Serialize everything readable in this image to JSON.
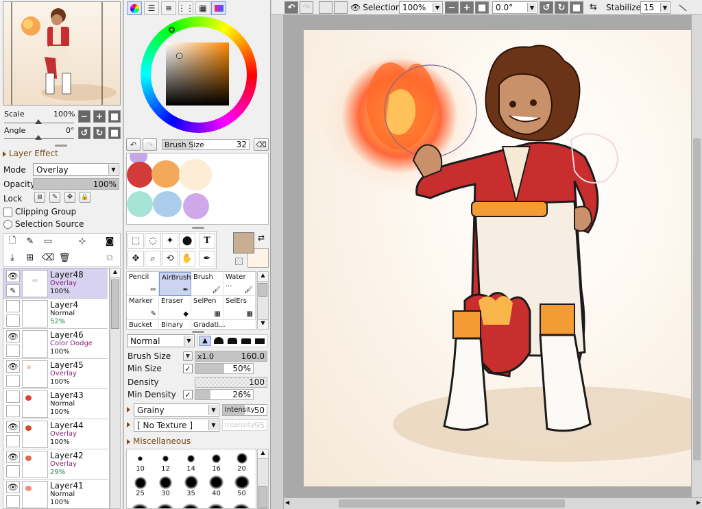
{
  "navigator": {
    "scale_label": "Scale",
    "scale_value": "100%",
    "angle_label": "Angle",
    "angle_value": "0°"
  },
  "layer_effect": {
    "title": "Layer Effect",
    "mode_label": "Mode",
    "mode_value": "Overlay",
    "opacity_label": "Opacity",
    "opacity_value": "100%",
    "lock_label": "Lock",
    "clipping_label": "Clipping Group",
    "selection_source_label": "Selection Source"
  },
  "layers": [
    {
      "name": "Layer48",
      "mode": "Overlay",
      "opacity": "100%",
      "visible": true,
      "selected": true
    },
    {
      "name": "Layer4",
      "mode": "Normal",
      "opacity": "52%",
      "visible": false,
      "selected": false
    },
    {
      "name": "Layer46",
      "mode": "Color Dodge",
      "opacity": "100%",
      "visible": true,
      "selected": false
    },
    {
      "name": "Layer45",
      "mode": "Overlay",
      "opacity": "100%",
      "visible": true,
      "selected": false
    },
    {
      "name": "Layer43",
      "mode": "Normal",
      "opacity": "100%",
      "visible": false,
      "selected": false
    },
    {
      "name": "Layer44",
      "mode": "Overlay",
      "opacity": "100%",
      "visible": true,
      "selected": false
    },
    {
      "name": "Layer42",
      "mode": "Overlay",
      "opacity": "29%",
      "visible": true,
      "selected": false
    },
    {
      "name": "Layer41",
      "mode": "Normal",
      "opacity": "100%",
      "visible": true,
      "selected": false
    }
  ],
  "brush_size_bar": {
    "label": "Brush Size",
    "value": "32"
  },
  "swatches": [
    "#c7a7e6",
    "#d33a3a",
    "#f4a95a",
    "#fdecd6",
    "#a6e4d6",
    "#a9cdea",
    "#cfa8ea"
  ],
  "colors": {
    "primary": "#c8ae92",
    "secondary": "#fdf3e6",
    "accent_selection": "#d6d2f0"
  },
  "tools": {
    "row1": [
      "rect-select",
      "lasso",
      "magic-wand",
      "select-pen",
      "text"
    ],
    "row2": [
      "move",
      "zoom",
      "rotate",
      "hand",
      "eyedropper"
    ],
    "text_tool_label": "T"
  },
  "brush_tools": [
    {
      "name": "Pencil",
      "selected": false
    },
    {
      "name": "AirBrush",
      "selected": true
    },
    {
      "name": "Brush",
      "selected": false
    },
    {
      "name": "Water ...",
      "selected": false
    },
    {
      "name": "Marker",
      "selected": false
    },
    {
      "name": "Eraser",
      "selected": false
    },
    {
      "name": "SelPen",
      "selected": false
    },
    {
      "name": "SelErs",
      "selected": false
    },
    {
      "name": "Bucket",
      "selected": false
    },
    {
      "name": "Binary ...",
      "selected": false
    },
    {
      "name": "Gradati...",
      "selected": false
    }
  ],
  "brush_settings": {
    "blend_mode": "Normal",
    "brush_size_label": "Brush Size",
    "brush_size_mult": "x1.0",
    "brush_size_value": "160.0",
    "min_size_label": "Min Size",
    "min_size_value": "50%",
    "min_size_fill": 0.5,
    "density_label": "Density",
    "density_value": "100",
    "min_density_label": "Min Density",
    "min_density_value": "26%",
    "min_density_fill": 0.26,
    "texture1": "Grainy",
    "intensity_label": "Intensity",
    "intensity1": "50",
    "texture2": "[ No Texture ]",
    "intensity2": "95",
    "misc_label": "Miscellaneous"
  },
  "brush_sizes": [
    "10",
    "12",
    "14",
    "16",
    "20",
    "25",
    "30",
    "35",
    "40",
    "50"
  ],
  "toolbar": {
    "selection_label": "Selection",
    "zoom_value": "100%",
    "rotation_value": "0.0°",
    "stabilizer_label": "Stabilizer",
    "stabilizer_value": "15"
  }
}
